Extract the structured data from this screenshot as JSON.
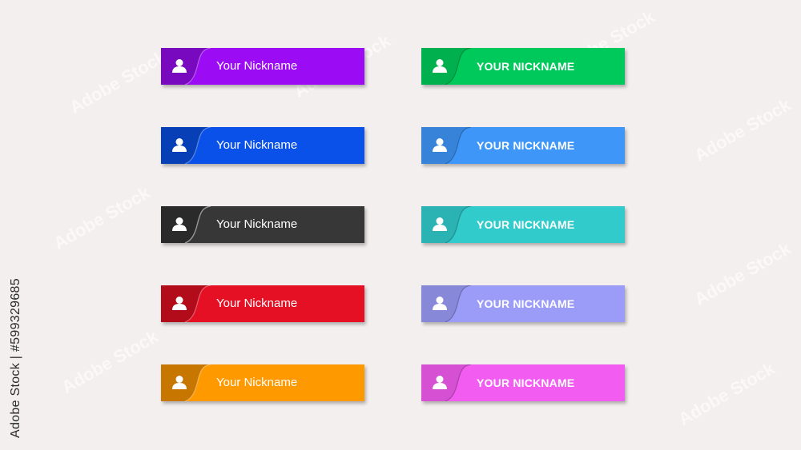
{
  "side_caption": "Adobe Stock | #599329685",
  "watermark_text": "Adobe Stock",
  "left_column": [
    {
      "label": "Your Nickname",
      "color": "#9b0cf5",
      "icon": "user-icon"
    },
    {
      "label": "Your Nickname",
      "color": "#0a51ea",
      "icon": "user-icon"
    },
    {
      "label": "Your Nickname",
      "color": "#373737",
      "icon": "user-icon"
    },
    {
      "label": "Your Nickname",
      "color": "#e51023",
      "icon": "user-icon"
    },
    {
      "label": "Your Nickname",
      "color": "#ff9900",
      "icon": "user-icon"
    }
  ],
  "right_column": [
    {
      "label": "YOUR NICKNAME",
      "color": "#00c95b",
      "icon": "user-icon"
    },
    {
      "label": "YOUR NICKNAME",
      "color": "#3e96f8",
      "icon": "user-icon"
    },
    {
      "label": "YOUR NICKNAME",
      "color": "#32cbcc",
      "icon": "user-icon"
    },
    {
      "label": "YOUR NICKNAME",
      "color": "#9b9bf8",
      "icon": "user-icon"
    },
    {
      "label": "YOUR NICKNAME",
      "color": "#f35cf1",
      "icon": "user-icon"
    }
  ]
}
